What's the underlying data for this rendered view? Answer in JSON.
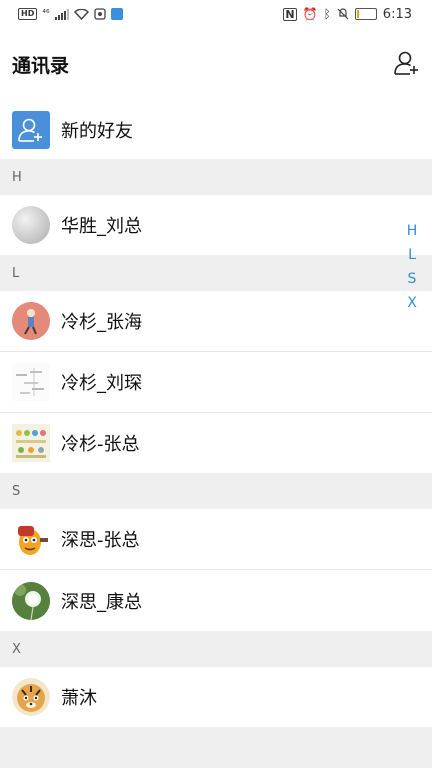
{
  "status_bar": {
    "hd": "HD",
    "signal": "⁴⁶",
    "time": "6:13",
    "battery_level": 0.12
  },
  "header": {
    "title": "通讯录",
    "add_icon": "add-contact-icon"
  },
  "new_friends": {
    "label": "新的好友",
    "icon": "add-friend-icon",
    "icon_bg": "#4a90d9"
  },
  "sections": [
    {
      "letter": "H",
      "contacts": [
        {
          "name": "华胜_刘总",
          "avatar": "grey-sphere"
        }
      ]
    },
    {
      "letter": "L",
      "contacts": [
        {
          "name": "冷杉_张海",
          "avatar": "runner-illustration"
        },
        {
          "name": "冷杉_刘琛",
          "avatar": "sketch-diagram"
        },
        {
          "name": "冷杉-张总",
          "avatar": "colorful-icons"
        }
      ]
    },
    {
      "letter": "S",
      "contacts": [
        {
          "name": "深思-张总",
          "avatar": "cartoon-character"
        },
        {
          "name": "深思_康总",
          "avatar": "dandelion"
        }
      ]
    },
    {
      "letter": "X",
      "contacts": [
        {
          "name": "萧沐",
          "avatar": "tiger-cartoon"
        }
      ]
    }
  ],
  "index_letters": [
    "H",
    "L",
    "S",
    "X"
  ],
  "colors": {
    "accent": "#2b8fd8",
    "section_bg": "#efefef"
  }
}
